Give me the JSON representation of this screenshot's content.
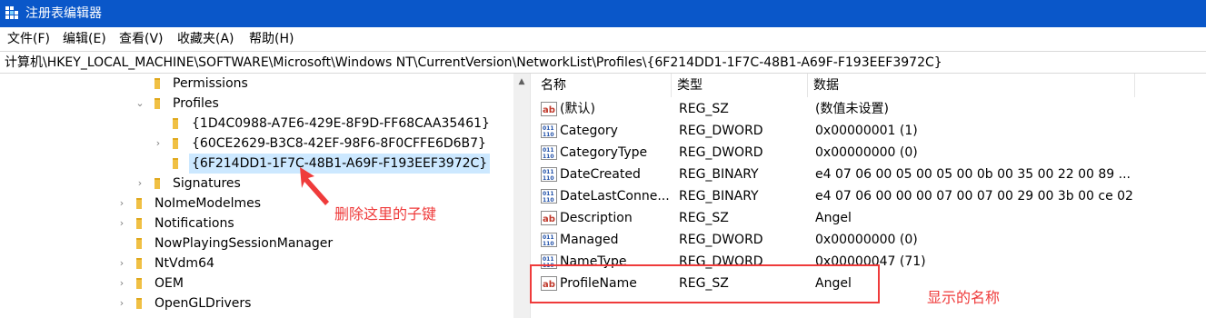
{
  "window": {
    "title": "注册表编辑器",
    "app_icon": "regedit-icon",
    "title_bar_color": "#0a57c9"
  },
  "menu": {
    "items": [
      "文件(F)",
      "编辑(E)",
      "查看(V)",
      "收藏夹(A)",
      "帮助(H)"
    ]
  },
  "address": {
    "path": "计算机\\HKEY_LOCAL_MACHINE\\SOFTWARE\\Microsoft\\Windows NT\\CurrentVersion\\NetworkList\\Profiles\\{6F214DD1-1F7C-48B1-A69F-F193EEF3972C}"
  },
  "tree": {
    "items": [
      {
        "label": "Permissions",
        "expander": "none",
        "selected": false
      },
      {
        "label": "Profiles",
        "expander": "expanded",
        "selected": false
      },
      {
        "label": "{1D4C0988-A7E6-429E-8F9D-FF68CAA35461}",
        "expander": "none",
        "selected": false
      },
      {
        "label": "{60CE2629-B3C8-42EF-98F6-8F0CFFE6D6B7}",
        "expander": "collapsed",
        "selected": false
      },
      {
        "label": "{6F214DD1-1F7C-48B1-A69F-F193EEF3972C}",
        "expander": "none",
        "selected": true
      },
      {
        "label": "Signatures",
        "expander": "collapsed",
        "selected": false
      },
      {
        "label": "NoImeModelmes",
        "expander": "collapsed",
        "selected": false
      },
      {
        "label": "Notifications",
        "expander": "collapsed",
        "selected": false
      },
      {
        "label": "NowPlayingSessionManager",
        "expander": "none",
        "selected": false
      },
      {
        "label": "NtVdm64",
        "expander": "collapsed",
        "selected": false
      },
      {
        "label": "OEM",
        "expander": "collapsed",
        "selected": false
      },
      {
        "label": "OpenGLDrivers",
        "expander": "collapsed",
        "selected": false
      }
    ],
    "selected_color": "#cce8ff",
    "folder_color": "#f0c044"
  },
  "values": {
    "columns": [
      "名称",
      "类型",
      "数据"
    ],
    "rows": [
      {
        "icon": "string-value-icon",
        "name": "(默认)",
        "type": "REG_SZ",
        "data": "(数值未设置)"
      },
      {
        "icon": "binary-value-icon",
        "name": "Category",
        "type": "REG_DWORD",
        "data": "0x00000001 (1)"
      },
      {
        "icon": "binary-value-icon",
        "name": "CategoryType",
        "type": "REG_DWORD",
        "data": "0x00000000 (0)"
      },
      {
        "icon": "binary-value-icon",
        "name": "DateCreated",
        "type": "REG_BINARY",
        "data": "e4 07 06 00 05 00 05 00 0b 00 35 00 22 00 89 ..."
      },
      {
        "icon": "binary-value-icon",
        "name": "DateLastConne...",
        "type": "REG_BINARY",
        "data": "e4 07 06 00 00 00 07 00 07 00 29 00 3b 00 ce 02"
      },
      {
        "icon": "string-value-icon",
        "name": "Description",
        "type": "REG_SZ",
        "data": "Angel"
      },
      {
        "icon": "binary-value-icon",
        "name": "Managed",
        "type": "REG_DWORD",
        "data": "0x00000000 (0)"
      },
      {
        "icon": "binary-value-icon",
        "name": "NameType",
        "type": "REG_DWORD",
        "data": "0x00000047 (71)"
      },
      {
        "icon": "string-value-icon",
        "name": "ProfileName",
        "type": "REG_SZ",
        "data": "Angel"
      }
    ]
  },
  "annotations": {
    "delete_note": "删除这里的子键",
    "name_note": "显示的名称",
    "color": "#ef3b3b"
  }
}
